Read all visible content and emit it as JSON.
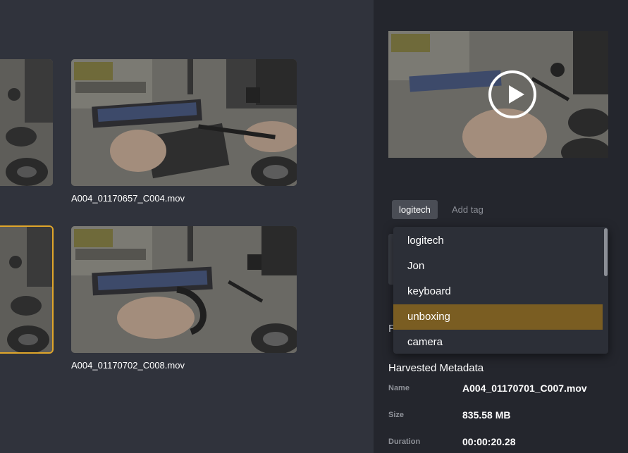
{
  "grid": {
    "items": [
      {
        "filename": ""
      },
      {
        "filename": "A004_01170657_C004.mov"
      },
      {
        "filename": ""
      },
      {
        "filename": "A004_01170702_C008.mov"
      }
    ],
    "selected_border_color": "#e0a62a"
  },
  "preview": {
    "icon": "play-circle-icon"
  },
  "tags": {
    "chip_label": "logitech",
    "add_placeholder": "Add tag"
  },
  "dropdown": {
    "options": [
      "logitech",
      "Jon",
      "keyboard",
      "unboxing",
      "camera"
    ],
    "highlighted": "unboxing",
    "highlight_color": "#7a5d22"
  },
  "partial_label": "P",
  "metadata": {
    "title": "Harvested Metadata",
    "rows": [
      {
        "label": "Name",
        "value": "A004_01170701_C007.mov"
      },
      {
        "label": "Size",
        "value": "835.58 MB"
      },
      {
        "label": "Duration",
        "value": "00:00:20.28"
      }
    ]
  }
}
